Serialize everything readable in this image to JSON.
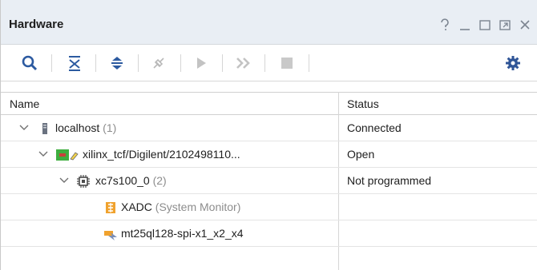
{
  "window": {
    "title": "Hardware",
    "controls": [
      "help-icon",
      "minimize-icon",
      "maximize-icon",
      "float-icon",
      "close-icon"
    ]
  },
  "toolbar": {
    "buttons": [
      "search-icon",
      "collapse-all-icon",
      "expand-all-icon",
      "auto-connect-icon",
      "run-icon",
      "run-all-icon",
      "stop-icon",
      "settings-icon"
    ]
  },
  "table": {
    "columns": [
      "Name",
      "Status"
    ],
    "rows": [
      {
        "name": "localhost",
        "count": "(1)",
        "status": "Connected",
        "icon": "server-icon"
      },
      {
        "name": "xilinx_tcf/Digilent/2102498110...",
        "count": "",
        "status": "Open",
        "icon": "jtag-cable-icon"
      },
      {
        "name": "xc7s100_0",
        "count": "(2)",
        "status": "Not programmed",
        "icon": "chip-icon"
      },
      {
        "name": "XADC",
        "count": "(System Monitor)",
        "status": "",
        "icon": "xadc-icon"
      },
      {
        "name": "mt25ql128-spi-x1_x2_x4",
        "count": "",
        "status": "",
        "icon": "flash-memory-icon"
      }
    ]
  },
  "colors": {
    "titlebar_bg": "#e9eef4",
    "toolbar_icon": "#2c5aa0",
    "settings_icon": "#2f5597"
  }
}
